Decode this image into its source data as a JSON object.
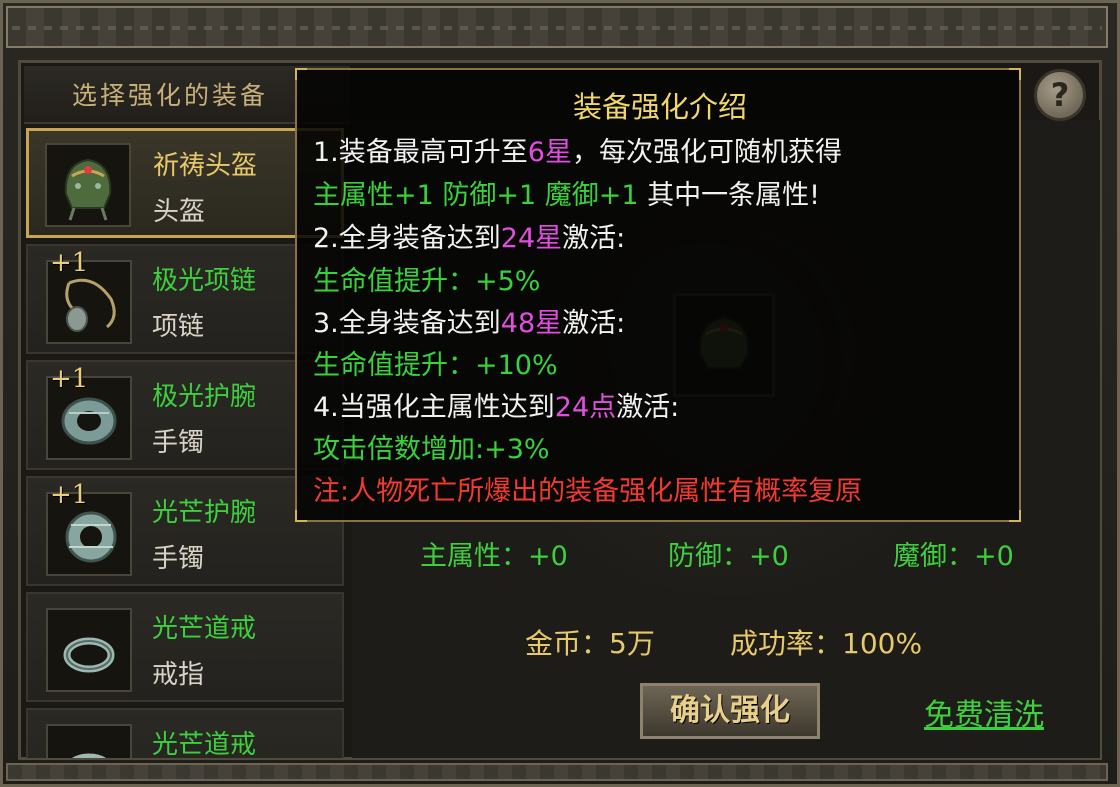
{
  "left_panel": {
    "title": "选择强化的装备",
    "items": [
      {
        "plus": "",
        "name": "祈祷头盔",
        "type": "头盔",
        "icon": "helmet-icon"
      },
      {
        "plus": "+1",
        "name": "极光项链",
        "type": "项链",
        "icon": "necklace-icon"
      },
      {
        "plus": "+1",
        "name": "极光护腕",
        "type": "手镯",
        "icon": "bracelet-icon"
      },
      {
        "plus": "+1",
        "name": "光芒护腕",
        "type": "手镯",
        "icon": "bracelet-icon"
      },
      {
        "plus": "",
        "name": "光芒道戒",
        "type": "戒指",
        "icon": "ring-icon"
      },
      {
        "plus": "",
        "name": "光芒道戒",
        "type": "",
        "icon": "ring-icon"
      }
    ]
  },
  "help_button": {
    "label": "?"
  },
  "stats": {
    "main_attr": "主属性：+0",
    "defense": "防御：+0",
    "magic_defense": "魔御：+0"
  },
  "cost": {
    "gold": "金币：5万",
    "success_rate": "成功率：100%"
  },
  "buttons": {
    "confirm": "确认强化",
    "free_wash": "免费清洗"
  },
  "tooltip": {
    "title": "装备强化介绍",
    "l1a": "1.装备最高可升至",
    "l1b": "6星",
    "l1c": "，每次强化可随机获得",
    "l2a": "主属性+1 防御+1 魔御+1",
    "l2b": " 其中一条属性!",
    "l3a": "2.全身装备达到",
    "l3b": "24星",
    "l3c": "激活:",
    "l4": "生命值提升：+5%",
    "l5a": "3.全身装备达到",
    "l5b": "48星",
    "l5c": "激活:",
    "l6": "生命值提升：+10%",
    "l7a": "4.当强化主属性达到",
    "l7b": "24点",
    "l7c": "激活:",
    "l8": "攻击倍数增加:+3%",
    "l9": "注:人物死亡所爆出的装备强化属性有概率复原"
  },
  "colors": {
    "green": "#38d23a",
    "gold": "#e7c86a",
    "purple": "#e24ee0",
    "red": "#f23a2e"
  }
}
